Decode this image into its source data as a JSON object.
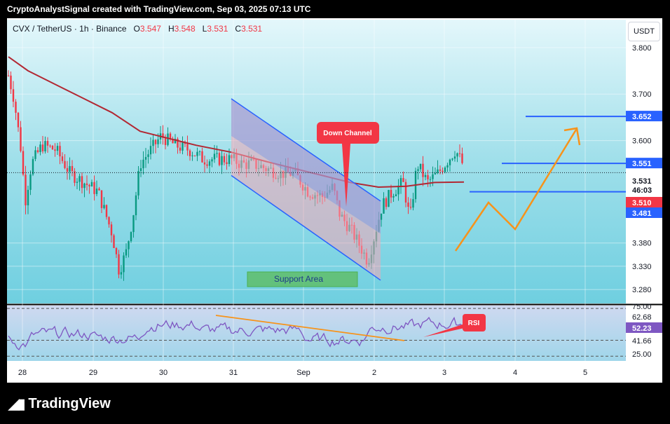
{
  "header": {
    "text": "CryptoAnalystSignal created with TradingView.com, Sep 03, 2025 07:13 UTC"
  },
  "legend": {
    "symbol": "CVX / TetherUS · 1h · Binance",
    "o_label": "O",
    "o": "3.547",
    "h_label": "H",
    "h": "3.548",
    "l_label": "L",
    "l": "3.531",
    "c_label": "C",
    "c": "3.531"
  },
  "currency_button": "USDT",
  "footer": {
    "brand": "TradingView"
  },
  "colors": {
    "up": "#089981",
    "down": "#f23645",
    "ma": "#b22833",
    "accent_blue": "#2962ff",
    "orange": "#f7931a",
    "rsi": "#7e57c2"
  },
  "chart_data": {
    "type": "candlestick",
    "x_ticks": [
      "28",
      "29",
      "30",
      "31",
      "Sep",
      "2",
      "3",
      "4",
      "5"
    ],
    "price_ticks": [
      "3.800",
      "3.700",
      "3.600",
      "3.380",
      "3.330",
      "3.280"
    ],
    "price_labels": [
      {
        "text": "3.652",
        "color": "#2962ff"
      },
      {
        "text": "3.551",
        "color": "#2962ff"
      },
      {
        "text": "3.531",
        "color": "#131722"
      },
      {
        "text": "46:03",
        "color": "#131722"
      },
      {
        "text": "3.510",
        "color": "#f23645"
      },
      {
        "text": "3.481",
        "color": "#2962ff"
      }
    ],
    "ylim": [
      3.25,
      3.86
    ],
    "annotations": {
      "down_channel": "Down Channel",
      "support_area": "Support Area",
      "rsi_label": "RSI"
    },
    "rsi": {
      "ylim": [
        20,
        78
      ],
      "ticks": [
        "75.00",
        "62.68",
        "41.66",
        "25.00"
      ],
      "current": "52.23"
    }
  }
}
